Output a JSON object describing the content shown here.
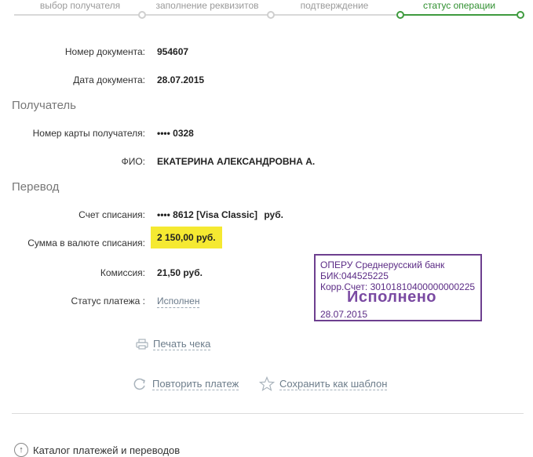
{
  "steps": [
    {
      "label": "выбор получателя",
      "active": false
    },
    {
      "label": "заполнение реквизитов",
      "active": false
    },
    {
      "label": "подтверждение",
      "active": false
    },
    {
      "label": "статус операции",
      "active": true
    }
  ],
  "document": {
    "number_label": "Номер документа:",
    "number_value": "954607",
    "date_label": "Дата документа:",
    "date_value": "28.07.2015"
  },
  "recipient": {
    "section_title": "Получатель",
    "card_label": "Номер карты получателя:",
    "card_value": "•••• 0328",
    "name_label": "ФИО:",
    "name_value": "ЕКАТЕРИНА АЛЕКСАНДРОВНА А."
  },
  "transfer": {
    "section_title": "Перевод",
    "account_label": "Счет списания:",
    "account_value": "•••• 8612  [Visa Classic]",
    "account_currency": "руб.",
    "amount_label": "Сумма в валюте списания:",
    "amount_value": "2 150,00  руб.",
    "fee_label": "Комиссия:",
    "fee_value": "21,50 руб.",
    "status_label": "Статус платежа :",
    "status_value": "Исполнен"
  },
  "stamp": {
    "line1": "ОПЕРУ Среднерусский банк",
    "line2": "БИК:044525225",
    "line3": "Корр.Счет: 30101810400000000225",
    "status": "Исполнено",
    "date": "28.07.2015"
  },
  "actions": {
    "print_label": "Печать чека",
    "repeat_label": "Повторить платеж",
    "save_template_label": "Сохранить как шаблон"
  },
  "footer": {
    "catalog_label": "Каталог платежей и переводов"
  },
  "colors": {
    "accent_green": "#3e9b3e",
    "highlight_yellow": "#f5e931",
    "stamp_purple": "#6d3f8f"
  }
}
